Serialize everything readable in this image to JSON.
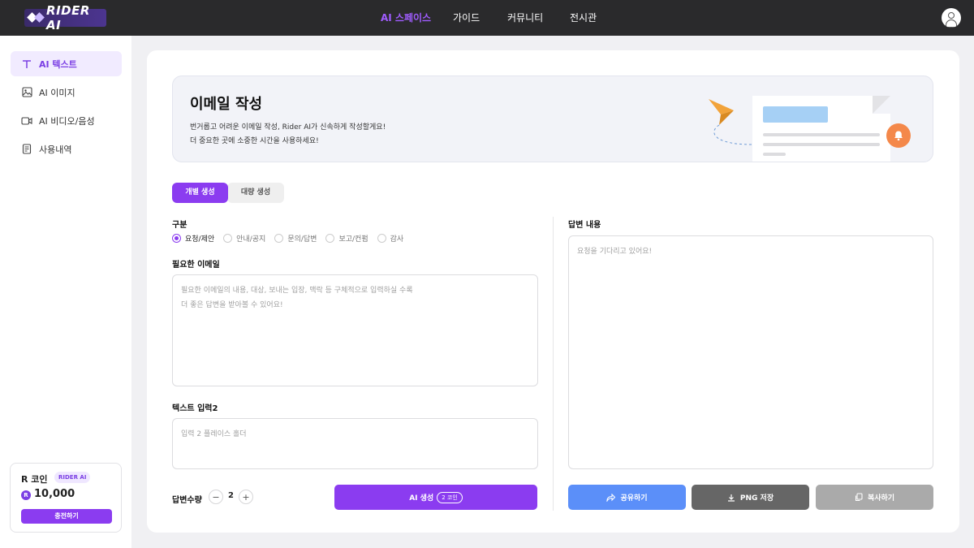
{
  "header": {
    "logo_text": "RIDER AI",
    "nav": [
      {
        "label": "AI 스페이스",
        "active": true
      },
      {
        "label": "가이드",
        "active": false
      },
      {
        "label": "커뮤니티",
        "active": false
      },
      {
        "label": "전시관",
        "active": false
      }
    ]
  },
  "sidebar": {
    "items": [
      {
        "label": "AI 텍스트",
        "icon": "text-icon",
        "active": true
      },
      {
        "label": "AI 이미지",
        "icon": "image-icon",
        "active": false
      },
      {
        "label": "AI 비디오/음성",
        "icon": "video-icon",
        "active": false
      },
      {
        "label": "사용내역",
        "icon": "document-icon",
        "active": false
      }
    ],
    "coin": {
      "title": "R 코인",
      "badge": "RIDER AI",
      "symbol": "R",
      "amount": "10,000",
      "charge_label": "충전하기"
    }
  },
  "banner": {
    "title": "이메일 작성",
    "desc_line1": "번거롭고 어려운 이메일 작성, Rider AI가 신속하게 작성할게요!",
    "desc_line2": "더 중요한 곳에 소중한 시간을 사용하세요!"
  },
  "tabs": {
    "individual": "개별 생성",
    "bulk": "대량 생성"
  },
  "form": {
    "category_label": "구분",
    "categories": [
      {
        "label": "요청/제안",
        "checked": true
      },
      {
        "label": "안내/공지",
        "checked": false
      },
      {
        "label": "문의/답변",
        "checked": false
      },
      {
        "label": "보고/컨펌",
        "checked": false
      },
      {
        "label": "감사",
        "checked": false
      }
    ],
    "email_label": "필요한 이메일",
    "email_placeholder": "필요한 이메일의 내용, 대상, 보내는 입장, 맥락 등 구체적으로 입력하실 수록\n더 좋은 답변을 받아볼 수 있어요!",
    "text2_label": "텍스트 입력2",
    "text2_placeholder": "입력 2 플레이스 홀더",
    "count_label": "답변수량",
    "count_minus": "−",
    "count_value": "2",
    "count_plus": "+",
    "generate_label": "AI 생성",
    "generate_cost": "2 코인"
  },
  "answer": {
    "label": "답변 내용",
    "placeholder": "요청을 기다리고 있어요!",
    "share_label": "공유하기",
    "png_label": "PNG 저장",
    "copy_label": "복사하기"
  },
  "colors": {
    "accent": "#8b3cf0",
    "share": "#5b8ff9",
    "png": "#666666",
    "copy": "#aaaaaa",
    "topbar": "#2a2a2c"
  }
}
